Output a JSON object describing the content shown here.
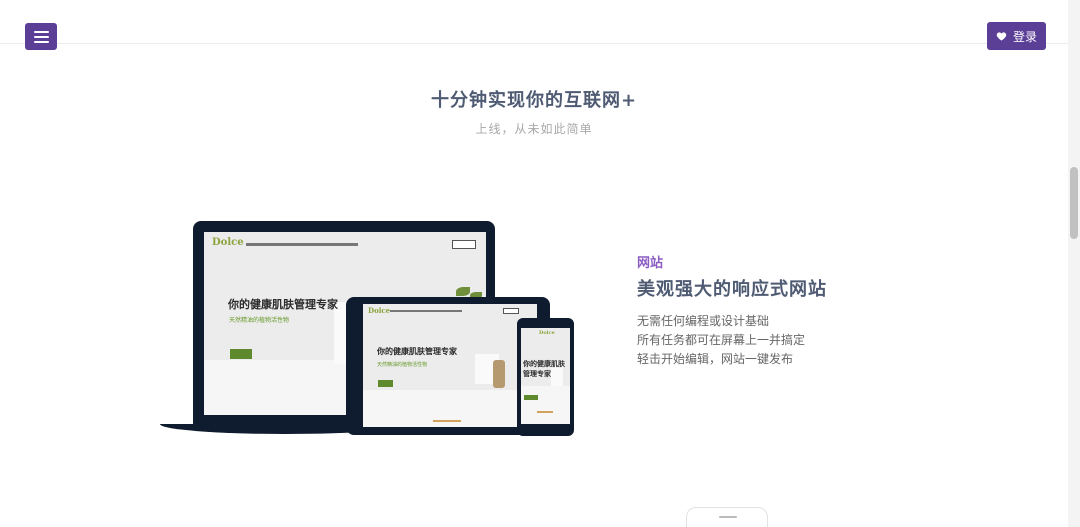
{
  "header": {
    "login_label": "登录"
  },
  "hero": {
    "title": "十分钟实现你的互联网+",
    "subtitle": "上线，从未如此简单"
  },
  "feature": {
    "tag": "网站",
    "title": "美观强大的响应式网站",
    "lines": [
      "无需任何编程或设计基础",
      "所有任务都可在屏幕上一并搞定",
      "轻击开始编辑，网站一键发布"
    ]
  },
  "mockup": {
    "brand": "Dolce",
    "headline": "你的健康肌肤管理专家",
    "tagline": "天然精油的植物活性物",
    "phone_headline_1": "你的健康肌肤",
    "phone_headline_2": "管理专家"
  },
  "colors": {
    "accent": "#5b3e96",
    "heading": "#4f5b73",
    "feature_tag": "#8a5cc2"
  }
}
